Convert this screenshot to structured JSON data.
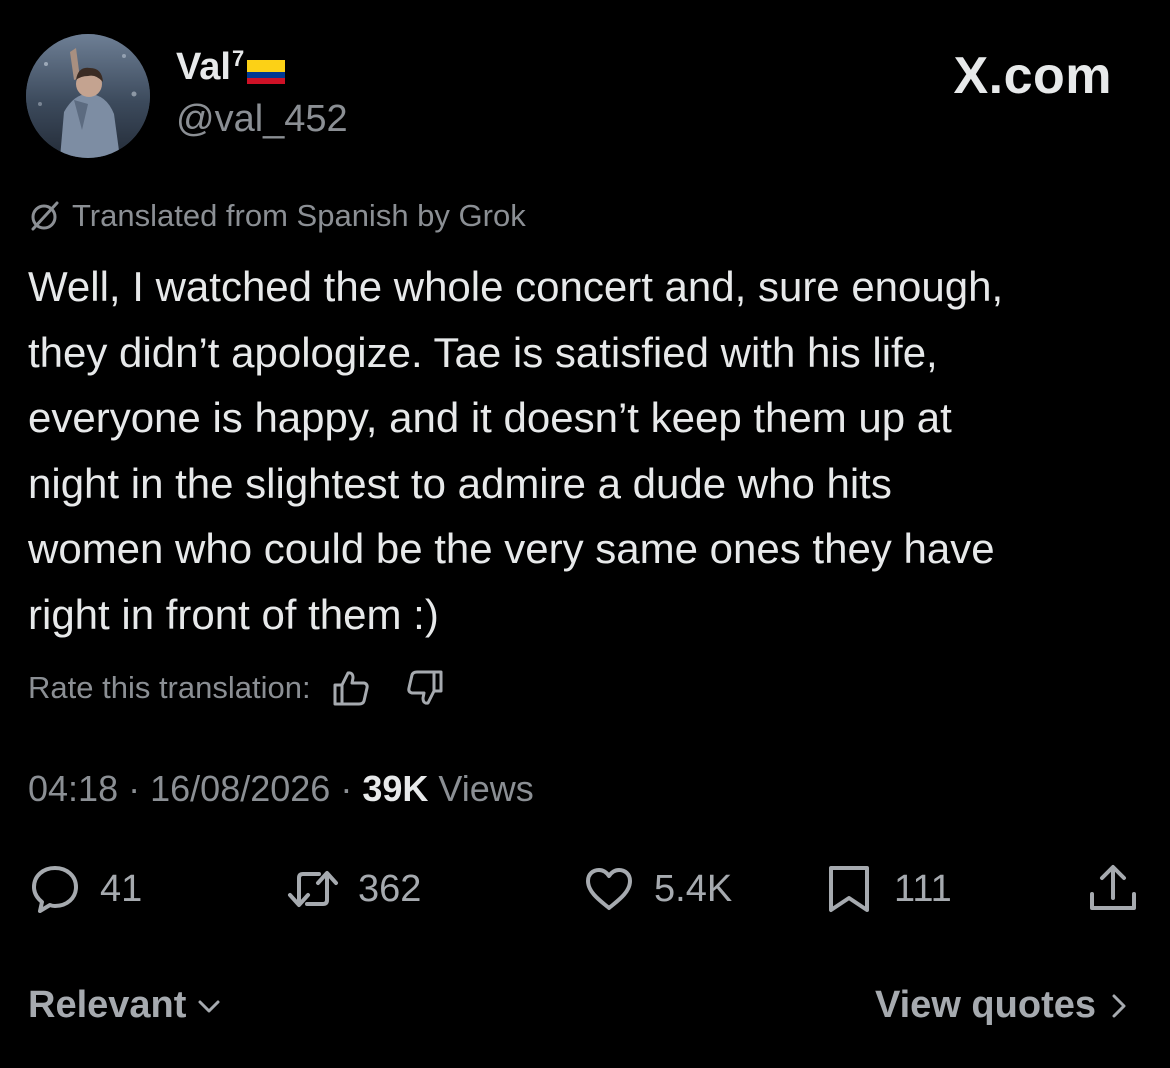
{
  "header": {
    "display_name": "Val",
    "name_superscript": "7",
    "flag": "colombia-flag-icon",
    "handle": "@val_452",
    "brand": "X.com"
  },
  "tweet": {
    "translated_notice": "Translated from Spanish by Grok",
    "text": "Well, I watched the whole concert and, sure enough,\nthey didn’t apologize. Tae is satisfied with his life,\neveryone is happy, and it doesn’t keep them up at\nnight in the slightest to admire a dude who hits\nwomen who could be the very same ones they have\nright in front of them :)",
    "rate_label": "Rate this translation:",
    "time": "04:18",
    "date": "16/08/2026",
    "views_count": "39K",
    "views_label": "Views",
    "separator": "·"
  },
  "actions": {
    "replies": "41",
    "reposts": "362",
    "likes": "5.4K",
    "bookmarks": "111"
  },
  "footer": {
    "sort_label": "Relevant",
    "quotes_label": "View quotes"
  },
  "colors": {
    "background": "#000000",
    "text_primary": "#e7e9ea",
    "text_secondary": "#8b8f94",
    "icon_color": "#a6aaaf",
    "flag_yellow": "#FCD116",
    "flag_blue": "#003893",
    "flag_red": "#CE1126"
  }
}
